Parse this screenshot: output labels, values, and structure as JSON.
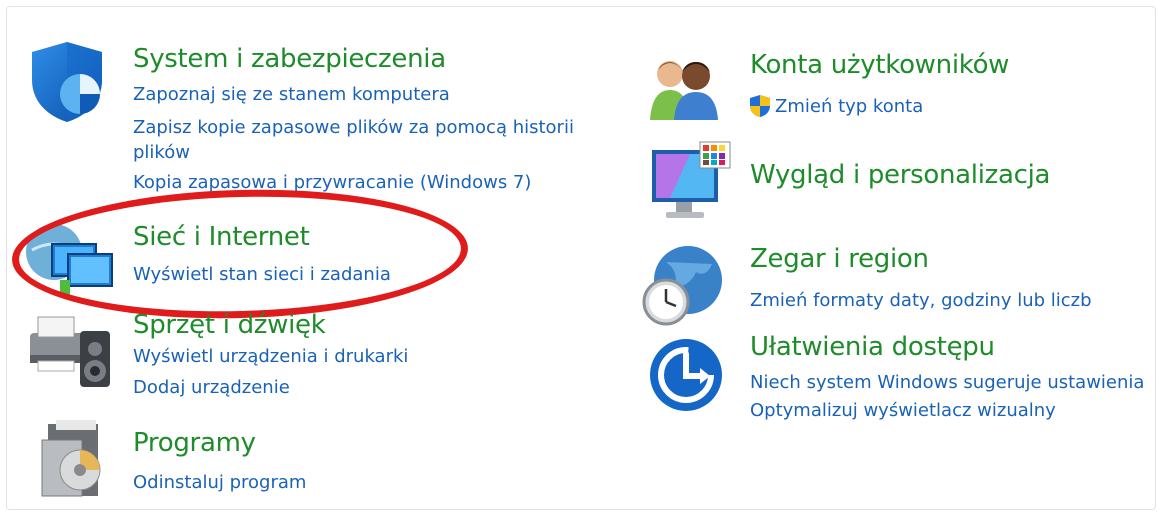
{
  "categories": {
    "system": {
      "title": "System i zabezpieczenia",
      "links": [
        "Zapoznaj się ze stanem komputera",
        "Zapisz kopie zapasowe plików za pomocą historii plików",
        "Kopia zapasowa i przywracanie (Windows 7)"
      ]
    },
    "network": {
      "title": "Sieć i Internet",
      "links": [
        "Wyświetl stan sieci i zadania"
      ]
    },
    "hardware": {
      "title": "Sprzęt i dźwięk",
      "links": [
        "Wyświetl urządzenia i drukarki",
        "Dodaj urządzenie"
      ]
    },
    "programs": {
      "title": "Programy",
      "links": [
        "Odinstaluj program"
      ]
    },
    "accounts": {
      "title": "Konta użytkowników",
      "links": [
        "Zmień typ konta"
      ]
    },
    "appearance": {
      "title": "Wygląd i personalizacja",
      "links": []
    },
    "clock": {
      "title": "Zegar i region",
      "links": [
        "Zmień formaty daty, godziny lub liczb"
      ]
    },
    "ease": {
      "title": "Ułatwienia dostępu",
      "links": [
        "Niech system Windows sugeruje ustawienia",
        "Optymalizuj wyświetlacz wizualny"
      ]
    }
  },
  "icons": {
    "system": "shield-icon",
    "network": "network-monitors-icon",
    "hardware": "printer-speaker-icon",
    "programs": "programs-disc-icon",
    "accounts": "users-icon",
    "appearance": "monitor-palette-icon",
    "clock": "globe-clock-icon",
    "ease": "accessibility-icon",
    "uac": "uac-shield-icon"
  },
  "colors": {
    "title": "#1e8c2a",
    "link": "#1a62b8",
    "annotation": "#e01b1b"
  }
}
